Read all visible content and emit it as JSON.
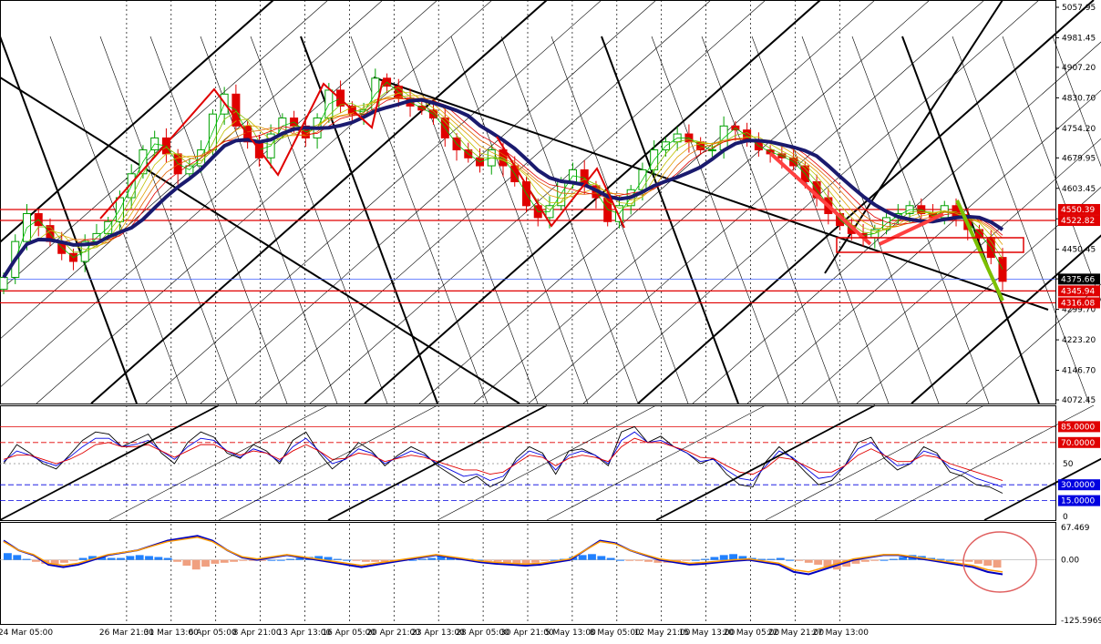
{
  "chart_data": [
    {
      "panel": "main",
      "type": "candlestick",
      "y_ticks": [
        "5057.95",
        "4981.45",
        "4907.20",
        "4830.70",
        "4754.20",
        "4679.95",
        "4603.45",
        "4526.95",
        "4450.45",
        "4376.20",
        "4299.70",
        "4223.20",
        "4146.70",
        "4072.45"
      ],
      "ylim": [
        4072.45,
        5057.95
      ],
      "price_labels": [
        {
          "label": "4550.39",
          "value": 4550.39,
          "color": "#e00000"
        },
        {
          "label": "4522.82",
          "value": 4522.82,
          "color": "#e00000"
        },
        {
          "label": "4375.66",
          "value": 4375.66,
          "color": "#000000"
        },
        {
          "label": "4345.94",
          "value": 4345.94,
          "color": "#e00000"
        },
        {
          "label": "4316.08",
          "value": 4316.08,
          "color": "#e00000"
        }
      ],
      "close": [
        4380,
        4470,
        4540,
        4510,
        4470,
        4440,
        4420,
        4470,
        4490,
        4520,
        4580,
        4640,
        4700,
        4730,
        4690,
        4640,
        4660,
        4700,
        4790,
        4840,
        4760,
        4720,
        4680,
        4740,
        4780,
        4760,
        4730,
        4780,
        4850,
        4810,
        4790,
        4800,
        4880,
        4860,
        4830,
        4810,
        4800,
        4780,
        4730,
        4700,
        4680,
        4660,
        4700,
        4660,
        4620,
        4560,
        4530,
        4560,
        4620,
        4650,
        4610,
        4580,
        4520,
        4560,
        4600,
        4650,
        4700,
        4720,
        4740,
        4720,
        4700,
        4700,
        4760,
        4750,
        4720,
        4700,
        4690,
        4680,
        4660,
        4620,
        4580,
        4540,
        4510,
        4490,
        4480,
        4500,
        4530,
        4540,
        4560,
        4540,
        4530,
        4560,
        4530,
        4500,
        4480,
        4430,
        4370
      ]
    },
    {
      "panel": "oscillator",
      "type": "line",
      "levels": [
        {
          "label": "85.0000",
          "value": 85
        },
        {
          "label": "70.0000",
          "value": 70
        },
        {
          "label": "30.0000",
          "value": 30
        },
        {
          "label": "15.0000",
          "value": 15
        }
      ],
      "axis_labels": [
        "50",
        "0"
      ],
      "series": [
        {
          "color": "#000000",
          "values": [
            50,
            68,
            60,
            50,
            45,
            58,
            72,
            80,
            78,
            66,
            72,
            78,
            60,
            50,
            70,
            80,
            75,
            60,
            55,
            68,
            62,
            50,
            72,
            80,
            60,
            45,
            55,
            70,
            62,
            48,
            58,
            66,
            60,
            48,
            40,
            32,
            38,
            28,
            34,
            55,
            66,
            60,
            40,
            62,
            64,
            58,
            48,
            80,
            85,
            70,
            76,
            66,
            60,
            50,
            55,
            40,
            30,
            28,
            52,
            66,
            55,
            42,
            30,
            34,
            48,
            70,
            75,
            55,
            44,
            50,
            66,
            60,
            42,
            38,
            30,
            28,
            22
          ]
        },
        {
          "color": "#0000e0",
          "values": [
            52,
            62,
            58,
            52,
            48,
            56,
            66,
            74,
            74,
            66,
            68,
            72,
            62,
            54,
            66,
            74,
            72,
            62,
            56,
            64,
            60,
            52,
            66,
            74,
            62,
            50,
            54,
            64,
            60,
            50,
            56,
            62,
            58,
            50,
            44,
            38,
            40,
            34,
            38,
            52,
            62,
            58,
            44,
            58,
            62,
            58,
            50,
            72,
            80,
            70,
            72,
            66,
            60,
            52,
            54,
            44,
            36,
            34,
            48,
            62,
            56,
            46,
            36,
            38,
            48,
            64,
            70,
            58,
            48,
            50,
            62,
            58,
            46,
            42,
            36,
            32,
            28
          ]
        },
        {
          "color": "#e00000",
          "values": [
            54,
            58,
            58,
            54,
            50,
            54,
            60,
            68,
            70,
            66,
            66,
            68,
            62,
            56,
            62,
            68,
            68,
            62,
            58,
            62,
            60,
            54,
            62,
            68,
            62,
            54,
            55,
            60,
            58,
            52,
            55,
            58,
            56,
            52,
            48,
            44,
            44,
            40,
            42,
            50,
            58,
            56,
            48,
            55,
            58,
            56,
            52,
            66,
            74,
            70,
            70,
            66,
            62,
            56,
            55,
            48,
            42,
            40,
            46,
            56,
            54,
            48,
            42,
            42,
            48,
            58,
            64,
            58,
            52,
            52,
            58,
            56,
            50,
            46,
            42,
            38,
            34
          ]
        }
      ]
    },
    {
      "panel": "macd",
      "type": "bar",
      "ticks": [
        "67.469",
        "0.00",
        "-125.5969"
      ],
      "ylim": [
        -125.5969,
        67.469
      ],
      "histogram": [
        14,
        10,
        2,
        -4,
        -8,
        -10,
        -6,
        -2,
        4,
        8,
        6,
        4,
        4,
        8,
        10,
        8,
        6,
        4,
        -4,
        -12,
        -20,
        -14,
        -8,
        -6,
        -4,
        -2,
        -2,
        -2,
        0,
        0,
        2,
        4,
        6,
        8,
        6,
        2,
        0,
        -2,
        -4,
        -4,
        -4,
        -2,
        -2,
        0,
        2,
        4,
        8,
        6,
        4,
        2,
        0,
        -2,
        -4,
        -6,
        -8,
        -10,
        -6,
        -2,
        0,
        2,
        6,
        10,
        12,
        8,
        4,
        0,
        -2,
        -2,
        -4,
        -6,
        -6,
        -4,
        -2,
        0,
        2,
        6,
        10,
        12,
        8,
        4,
        2,
        2,
        4,
        0,
        -2,
        -6,
        -10,
        -14,
        -20,
        -14,
        -8,
        -4,
        -2,
        0,
        2,
        6,
        10,
        8,
        4,
        2,
        0,
        -2,
        -4,
        -8,
        -12,
        -16
      ],
      "signal": [
        40,
        20,
        10,
        -10,
        -15,
        -10,
        0,
        10,
        15,
        20,
        30,
        40,
        45,
        50,
        40,
        20,
        5,
        0,
        5,
        10,
        5,
        0,
        -5,
        -10,
        -15,
        -10,
        -5,
        0,
        5,
        10,
        5,
        0,
        -5,
        -8,
        -10,
        -12,
        -10,
        -5,
        0,
        20,
        40,
        35,
        20,
        10,
        0,
        -5,
        -10,
        -8,
        -5,
        -2,
        0,
        -5,
        -10,
        -25,
        -30,
        -20,
        -10,
        0,
        5,
        10,
        10,
        5,
        0,
        -5,
        -10,
        -15,
        -25,
        -30
      ]
    }
  ],
  "x_labels": [
    "24 Mar 05:00",
    "26 Mar 21:00",
    "31 Mar 13:00",
    "6 Apr 05:00",
    "8 Apr 21:00",
    "13 Apr 13:00",
    "16 Apr 05:00",
    "20 Apr 21:00",
    "23 Apr 13:00",
    "28 Apr 05:00",
    "30 Apr 21:00",
    "5 May 13:00",
    "8 May 05:00",
    "12 May 21:00",
    "15 May 13:00",
    "20 May 05:00",
    "22 May 21:00",
    "27 May 13:00"
  ],
  "colors": {
    "up_candle": "#00a000",
    "down_candle": "#e00000",
    "ma_thick": "#1a1a6e",
    "level_red": "#e00000",
    "histogram_pos": "#2080ff",
    "histogram_neg": "#f0a080",
    "signal_line": "#ff9900",
    "macd_line": "#0000c0",
    "annotation_green": "#7cc000",
    "circle": "#e06060"
  }
}
